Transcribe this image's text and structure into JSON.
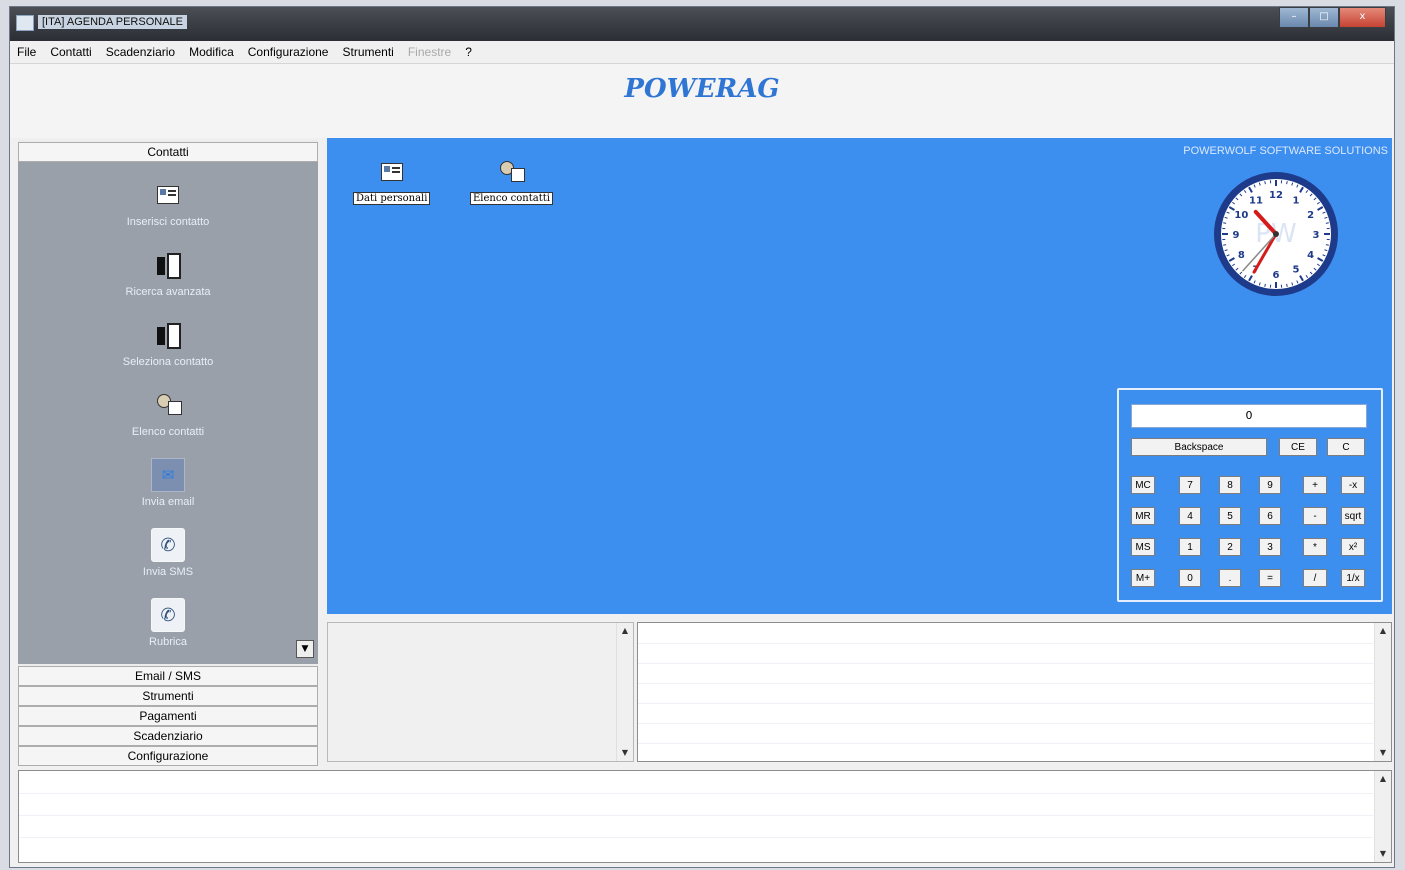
{
  "window": {
    "title": "[ITA] AGENDA PERSONALE",
    "min_label": "–",
    "max_label": "□",
    "close_label": "x"
  },
  "menu": [
    "File",
    "Contatti",
    "Scadenziario",
    "Modifica",
    "Configurazione",
    "Strumenti",
    "Finestre",
    "?"
  ],
  "menu_disabled_index": 6,
  "banner": {
    "title": "POWERAG"
  },
  "sidebar": {
    "groups": [
      "Contatti",
      "Email / SMS",
      "Strumenti",
      "Pagamenti",
      "Scadenziario",
      "Configurazione"
    ],
    "items": [
      {
        "label": "Inserisci contatto",
        "icon": "id-card-icon"
      },
      {
        "label": "Ricerca avanzata",
        "icon": "address-book-icon"
      },
      {
        "label": "Seleziona contatto",
        "icon": "address-book-icon"
      },
      {
        "label": "Elenco contatti",
        "icon": "contact-list-icon"
      },
      {
        "label": "Invia email",
        "icon": "email-icon"
      },
      {
        "label": "Invia SMS",
        "icon": "phone-icon"
      },
      {
        "label": "Rubrica",
        "icon": "phone-icon"
      }
    ]
  },
  "main": {
    "company": "POWERWOLF SOFTWARE SOLUTIONS",
    "desktop_items": [
      {
        "label": "Dati personali",
        "icon": "id-card-icon"
      },
      {
        "label": "Elenco contatti",
        "icon": "contact-list-icon"
      }
    ],
    "clock": {
      "hour": 10,
      "minute": 35,
      "second": 37,
      "watermark": "PW"
    }
  },
  "calculator": {
    "display": "0",
    "backspace": "Backspace",
    "ce": "CE",
    "c": "C",
    "rows": [
      [
        "MC",
        "7",
        "8",
        "9",
        "+",
        "-x"
      ],
      [
        "MR",
        "4",
        "5",
        "6",
        "-",
        "sqrt"
      ],
      [
        "MS",
        "1",
        "2",
        "3",
        "*",
        "x²"
      ],
      [
        "M+",
        "0",
        ".",
        "=",
        "/",
        "1/x"
      ]
    ]
  },
  "colors": {
    "main_bg": "#3c8fef",
    "brand": "#2f76d4",
    "sidebar_bg": "#9aa0a9"
  }
}
